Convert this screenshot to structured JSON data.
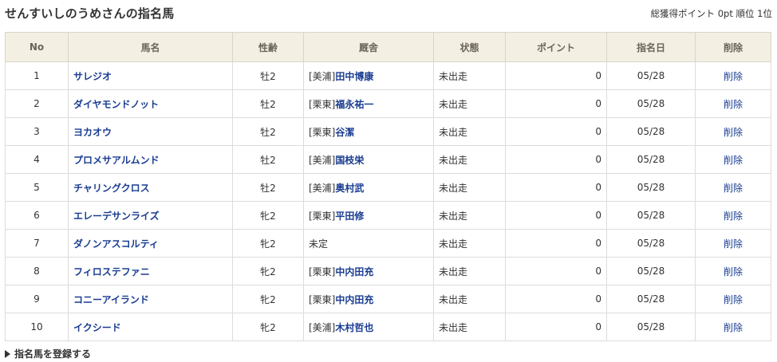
{
  "title": "せんすいしのうめさんの指名馬",
  "summary": {
    "points_label": "総獲得ポイント",
    "points_value": "0pt",
    "rank_label": "順位",
    "rank_value": "1位"
  },
  "table": {
    "headers": [
      "No",
      "馬名",
      "性齢",
      "厩舎",
      "状態",
      "ポイント",
      "指名日",
      "削除"
    ],
    "rows": [
      {
        "no": "1",
        "name": "サレジオ",
        "sexage": "牡2",
        "region": "[美浦]",
        "trainer": "田中博康",
        "status": "未出走",
        "points": "0",
        "date": "05/28",
        "delete": "削除"
      },
      {
        "no": "2",
        "name": "ダイヤモンドノット",
        "sexage": "牡2",
        "region": "[栗東]",
        "trainer": "福永祐一",
        "status": "未出走",
        "points": "0",
        "date": "05/28",
        "delete": "削除"
      },
      {
        "no": "3",
        "name": "ヨカオウ",
        "sexage": "牡2",
        "region": "[栗東]",
        "trainer": "谷潔",
        "status": "未出走",
        "points": "0",
        "date": "05/28",
        "delete": "削除"
      },
      {
        "no": "4",
        "name": "プロメサアルムンド",
        "sexage": "牡2",
        "region": "[美浦]",
        "trainer": "国枝栄",
        "status": "未出走",
        "points": "0",
        "date": "05/28",
        "delete": "削除"
      },
      {
        "no": "5",
        "name": "チャリングクロス",
        "sexage": "牡2",
        "region": "[美浦]",
        "trainer": "奥村武",
        "status": "未出走",
        "points": "0",
        "date": "05/28",
        "delete": "削除"
      },
      {
        "no": "6",
        "name": "エレーデサンライズ",
        "sexage": "牝2",
        "region": "[栗東]",
        "trainer": "平田修",
        "status": "未出走",
        "points": "0",
        "date": "05/28",
        "delete": "削除"
      },
      {
        "no": "7",
        "name": "ダノンアスコルティ",
        "sexage": "牝2",
        "region": "",
        "trainer": "",
        "stable_plain": "未定",
        "status": "未出走",
        "points": "0",
        "date": "05/28",
        "delete": "削除"
      },
      {
        "no": "8",
        "name": "フィロステファニ",
        "sexage": "牝2",
        "region": "[栗東]",
        "trainer": "中内田充",
        "status": "未出走",
        "points": "0",
        "date": "05/28",
        "delete": "削除"
      },
      {
        "no": "9",
        "name": "コニーアイランド",
        "sexage": "牝2",
        "region": "[栗東]",
        "trainer": "中内田充",
        "status": "未出走",
        "points": "0",
        "date": "05/28",
        "delete": "削除"
      },
      {
        "no": "10",
        "name": "イクシード",
        "sexage": "牝2",
        "region": "[美浦]",
        "trainer": "木村哲也",
        "status": "未出走",
        "points": "0",
        "date": "05/28",
        "delete": "削除"
      }
    ]
  },
  "register_link": "指名馬を登録する",
  "colors": {
    "link": "#1a3d91",
    "header_bg": "#f3efe3"
  }
}
